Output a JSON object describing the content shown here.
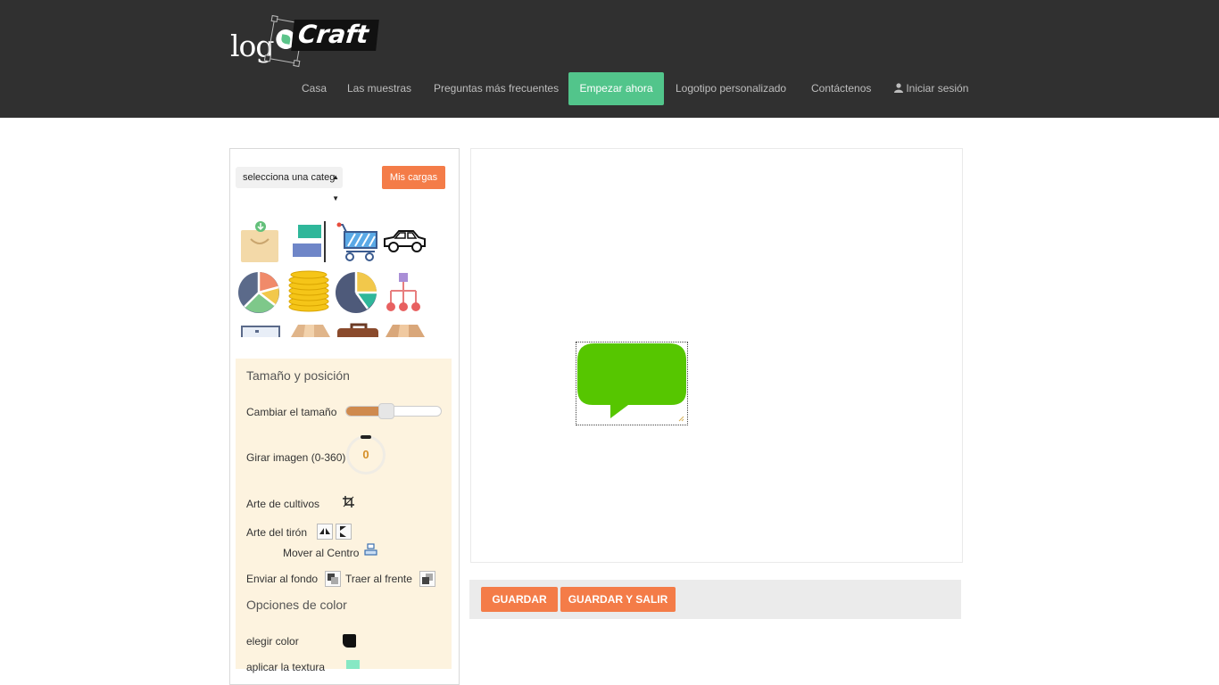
{
  "logo": {
    "text_left": "log",
    "text_right": "Craft"
  },
  "nav": {
    "items": [
      {
        "label": "Casa"
      },
      {
        "label": "Las muestras"
      },
      {
        "label": "Preguntas más frecuentes"
      },
      {
        "label": "Empezar ahora"
      },
      {
        "label": "Logotipo personalizado"
      },
      {
        "label": "Contáctenos"
      },
      {
        "label": "Iniciar sesión"
      }
    ],
    "active_color": "#52c58b"
  },
  "sidebar": {
    "category_select": {
      "value": "selecciona una categ"
    },
    "uploads_button": "Mis cargas",
    "icons": [
      "shopping-bag-icon",
      "layout-blocks-icon",
      "shopping-cart-icon",
      "car-icon",
      "pie-chart-icon",
      "coins-stack-icon",
      "pie-chart-alt-icon",
      "org-chart-icon",
      "monitor-icon",
      "box-icon",
      "briefcase-icon",
      "box-alt-icon"
    ],
    "size_position": {
      "title": "Tamaño y posición",
      "resize_label": "Cambiar el tamaño",
      "resize_value": 0.42,
      "rotate_label": "Girar imagen (0-360)",
      "rotate_value": "0",
      "crop_label": "Arte de cultivos",
      "flip_label": "Arte del tirón",
      "center_label": "Mover al Centro",
      "send_back_label": "Enviar al fondo",
      "bring_front_label": "Traer al frente"
    },
    "color_options": {
      "title": "Opciones de color",
      "choose_color_label": "elegir color",
      "choose_color_value": "#111111",
      "texture_label": "aplicar la textura",
      "texture_color": "#86e8c4"
    }
  },
  "canvas": {
    "shape": "speech-bubble",
    "shape_color": "#56c600"
  },
  "actions": {
    "save": "GUARDAR",
    "save_exit": "GUARDAR Y SALIR"
  },
  "colors": {
    "header_bg": "#303030",
    "accent_orange": "#f47c48",
    "panel_bg": "#fdf3df"
  }
}
